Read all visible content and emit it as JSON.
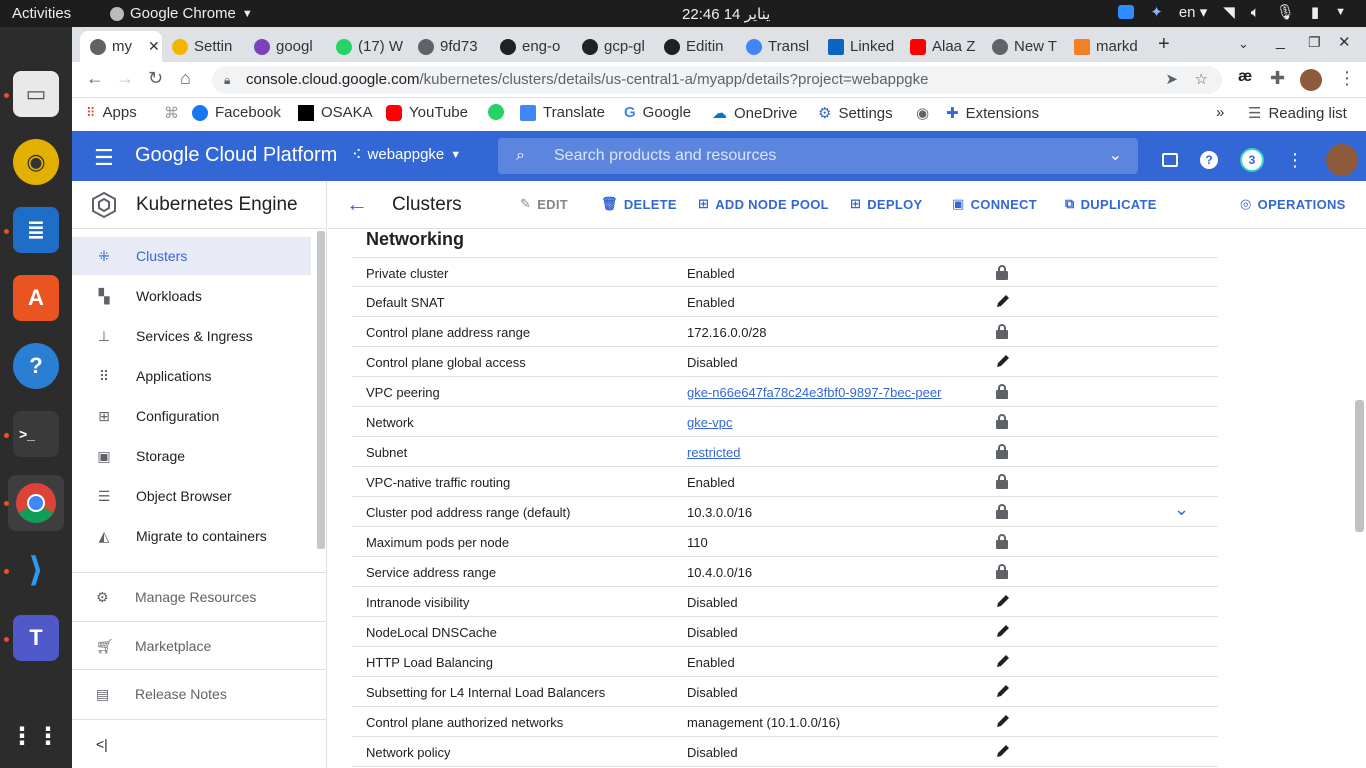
{
  "os": {
    "activities": "Activities",
    "app_name": "Google Chrome",
    "clock": "22:46  14 يناير",
    "lang": "en"
  },
  "browser": {
    "tabs": [
      {
        "label": "my",
        "color": "#5f6368"
      },
      {
        "label": "Settin",
        "color": "#f4b400"
      },
      {
        "label": "googl",
        "color": "#7b42bc"
      },
      {
        "label": "(17) W",
        "color": "#25d366"
      },
      {
        "label": "9fd73",
        "color": "#5f6368"
      },
      {
        "label": "eng-o",
        "color": "#202124"
      },
      {
        "label": "gcp-gl",
        "color": "#202124"
      },
      {
        "label": "Editin",
        "color": "#202124"
      },
      {
        "label": "Transl",
        "color": "#4285f4"
      },
      {
        "label": "Linked",
        "color": "#0a66c2"
      },
      {
        "label": "Alaa Z",
        "color": "#ff0000"
      },
      {
        "label": "New T",
        "color": "#5f6368"
      },
      {
        "label": "markd",
        "color": "#f48024"
      }
    ],
    "url_host": "console.cloud.google.com",
    "url_path": "/kubernetes/clusters/details/us-central1-a/myapp/details?project=webappgke",
    "bookmarks": [
      "Apps",
      "Facebook",
      "OSAKA",
      "YouTube",
      "Translate",
      "Google",
      "OneDrive",
      "Settings",
      "Extensions"
    ],
    "reading_list": "Reading list"
  },
  "gcp": {
    "brand": "Google Cloud Platform",
    "project": "webappgke",
    "search_placeholder": "Search products and resources",
    "notif_count": "3"
  },
  "sidenav": {
    "product": "Kubernetes Engine",
    "items": [
      {
        "label": "Clusters",
        "icon": "clusters-icon"
      },
      {
        "label": "Workloads",
        "icon": "workloads-icon"
      },
      {
        "label": "Services & Ingress",
        "icon": "services-icon"
      },
      {
        "label": "Applications",
        "icon": "applications-icon"
      },
      {
        "label": "Configuration",
        "icon": "configuration-icon"
      },
      {
        "label": "Storage",
        "icon": "storage-icon"
      },
      {
        "label": "Object Browser",
        "icon": "object-browser-icon"
      },
      {
        "label": "Migrate to containers",
        "icon": "migrate-icon"
      }
    ],
    "footer": [
      {
        "label": "Manage Resources",
        "icon": "manage-resources-icon"
      },
      {
        "label": "Marketplace",
        "icon": "marketplace-icon"
      },
      {
        "label": "Release Notes",
        "icon": "release-notes-icon"
      }
    ],
    "collapse": "<|"
  },
  "toolbar": {
    "title": "Clusters",
    "edit": "EDIT",
    "delete": "DELETE",
    "add_node_pool": "ADD NODE POOL",
    "deploy": "DEPLOY",
    "connect": "CONNECT",
    "duplicate": "DUPLICATE",
    "operations": "OPERATIONS"
  },
  "networking": {
    "title": "Networking",
    "rows": [
      {
        "key": "Private cluster",
        "value": "Enabled",
        "link": false,
        "icon": "lock"
      },
      {
        "key": "Default SNAT",
        "value": "Enabled",
        "link": false,
        "icon": "edit"
      },
      {
        "key": "Control plane address range",
        "value": "172.16.0.0/28",
        "link": false,
        "icon": "lock"
      },
      {
        "key": "Control plane global access",
        "value": "Disabled",
        "link": false,
        "icon": "edit"
      },
      {
        "key": "VPC peering",
        "value": "gke-n66e647fa78c24e3fbf0-9897-7bec-peer",
        "link": true,
        "icon": "lock"
      },
      {
        "key": "Network",
        "value": "gke-vpc",
        "link": true,
        "icon": "lock"
      },
      {
        "key": "Subnet",
        "value": "restricted",
        "link": true,
        "icon": "lock"
      },
      {
        "key": "VPC-native traffic routing",
        "value": "Enabled",
        "link": false,
        "icon": "lock"
      },
      {
        "key": "Cluster pod address range (default)",
        "value": "10.3.0.0/16",
        "link": false,
        "icon": "lock",
        "expand": true
      },
      {
        "key": "Maximum pods per node",
        "value": "110",
        "link": false,
        "icon": "lock"
      },
      {
        "key": "Service address range",
        "value": "10.4.0.0/16",
        "link": false,
        "icon": "lock"
      },
      {
        "key": "Intranode visibility",
        "value": "Disabled",
        "link": false,
        "icon": "edit"
      },
      {
        "key": "NodeLocal DNSCache",
        "value": "Disabled",
        "link": false,
        "icon": "edit"
      },
      {
        "key": "HTTP Load Balancing",
        "value": "Enabled",
        "link": false,
        "icon": "edit"
      },
      {
        "key": "Subsetting for L4 Internal Load Balancers",
        "value": "Disabled",
        "link": false,
        "icon": "edit"
      },
      {
        "key": "Control plane authorized networks",
        "value": "management (10.1.0.0/16)",
        "link": false,
        "icon": "edit"
      },
      {
        "key": "Network policy",
        "value": "Disabled",
        "link": false,
        "icon": "edit"
      }
    ]
  }
}
